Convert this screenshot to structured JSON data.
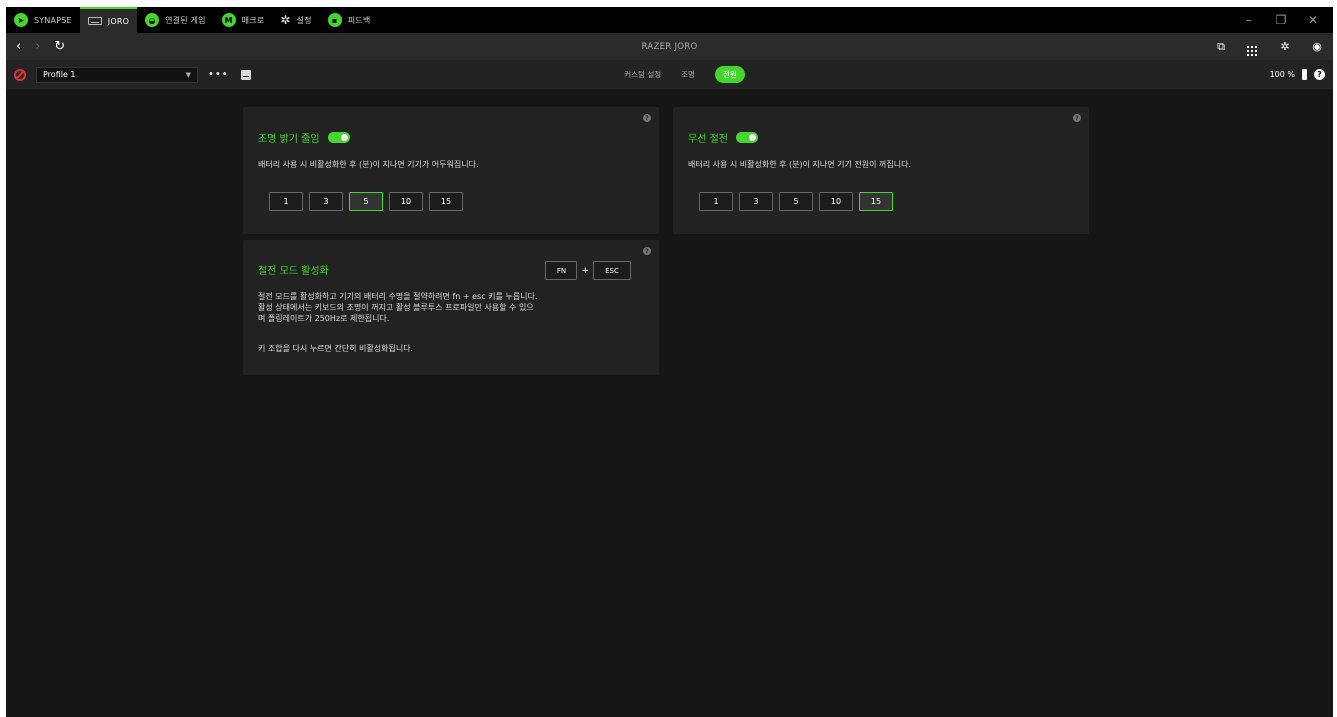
{
  "titlebar": {
    "tabs": [
      {
        "label": "SYNAPSE",
        "icon": "synapse-icon"
      },
      {
        "label": "JORO",
        "icon": "keyboard-icon",
        "active": true
      },
      {
        "label": "연결된 게임",
        "icon": "gamepad-icon"
      },
      {
        "label": "매크로",
        "icon": "macro-icon",
        "icon_text": "M"
      },
      {
        "label": "설정",
        "icon": "gear-icon"
      },
      {
        "label": "피드백",
        "icon": "feedback-icon"
      }
    ],
    "window_controls": {
      "minimize": "–",
      "restore": "❐",
      "close": "✕"
    }
  },
  "navbar": {
    "back": "‹",
    "forward": "›",
    "refresh": "↻",
    "device_title": "RAZER JORO"
  },
  "profilebar": {
    "profile_name": "Profile 1",
    "more": "•••",
    "subtabs": [
      {
        "label": "커스텀 설정"
      },
      {
        "label": "조명"
      },
      {
        "label": "전원",
        "active": true
      }
    ],
    "battery_text": "100 %",
    "help": "?"
  },
  "cards": {
    "dim": {
      "title": "조명 밝기 줄임",
      "enabled": true,
      "description": "배터리 사용 시 비활성화한 후 (분)이 지나면 기기가 어두워집니다.",
      "options": [
        "1",
        "3",
        "5",
        "10",
        "15"
      ],
      "selected": "5",
      "help": "?"
    },
    "wireless": {
      "title": "무선 절전",
      "enabled": true,
      "description": "배터리 사용 시 비활성화한 후 (분)이 지나면 기기 전원이 꺼집니다.",
      "options": [
        "1",
        "3",
        "5",
        "10",
        "15"
      ],
      "selected": "15",
      "help": "?"
    },
    "power_save": {
      "title": "절전 모드 활성화",
      "key1": "FN",
      "plus": "+",
      "key2": "ESC",
      "desc_lines": [
        "절전 모드를 활성화하고 기기의 배터리 수명을 절약하려면 fn + esc 키를 누릅니다.",
        "활성 상태에서는 키보드의 조명이 꺼지고 활성 블루투스 프로파일만 사용할 수 있으",
        "며 폴링레이트가 250Hz로 제한됩니다."
      ],
      "desc_extra": "키 조합을 다시 누르면 간단히 비활성화됩니다.",
      "help": "?"
    }
  },
  "colors": {
    "accent": "#44d62c",
    "background": "#161616",
    "card": "#222222"
  }
}
